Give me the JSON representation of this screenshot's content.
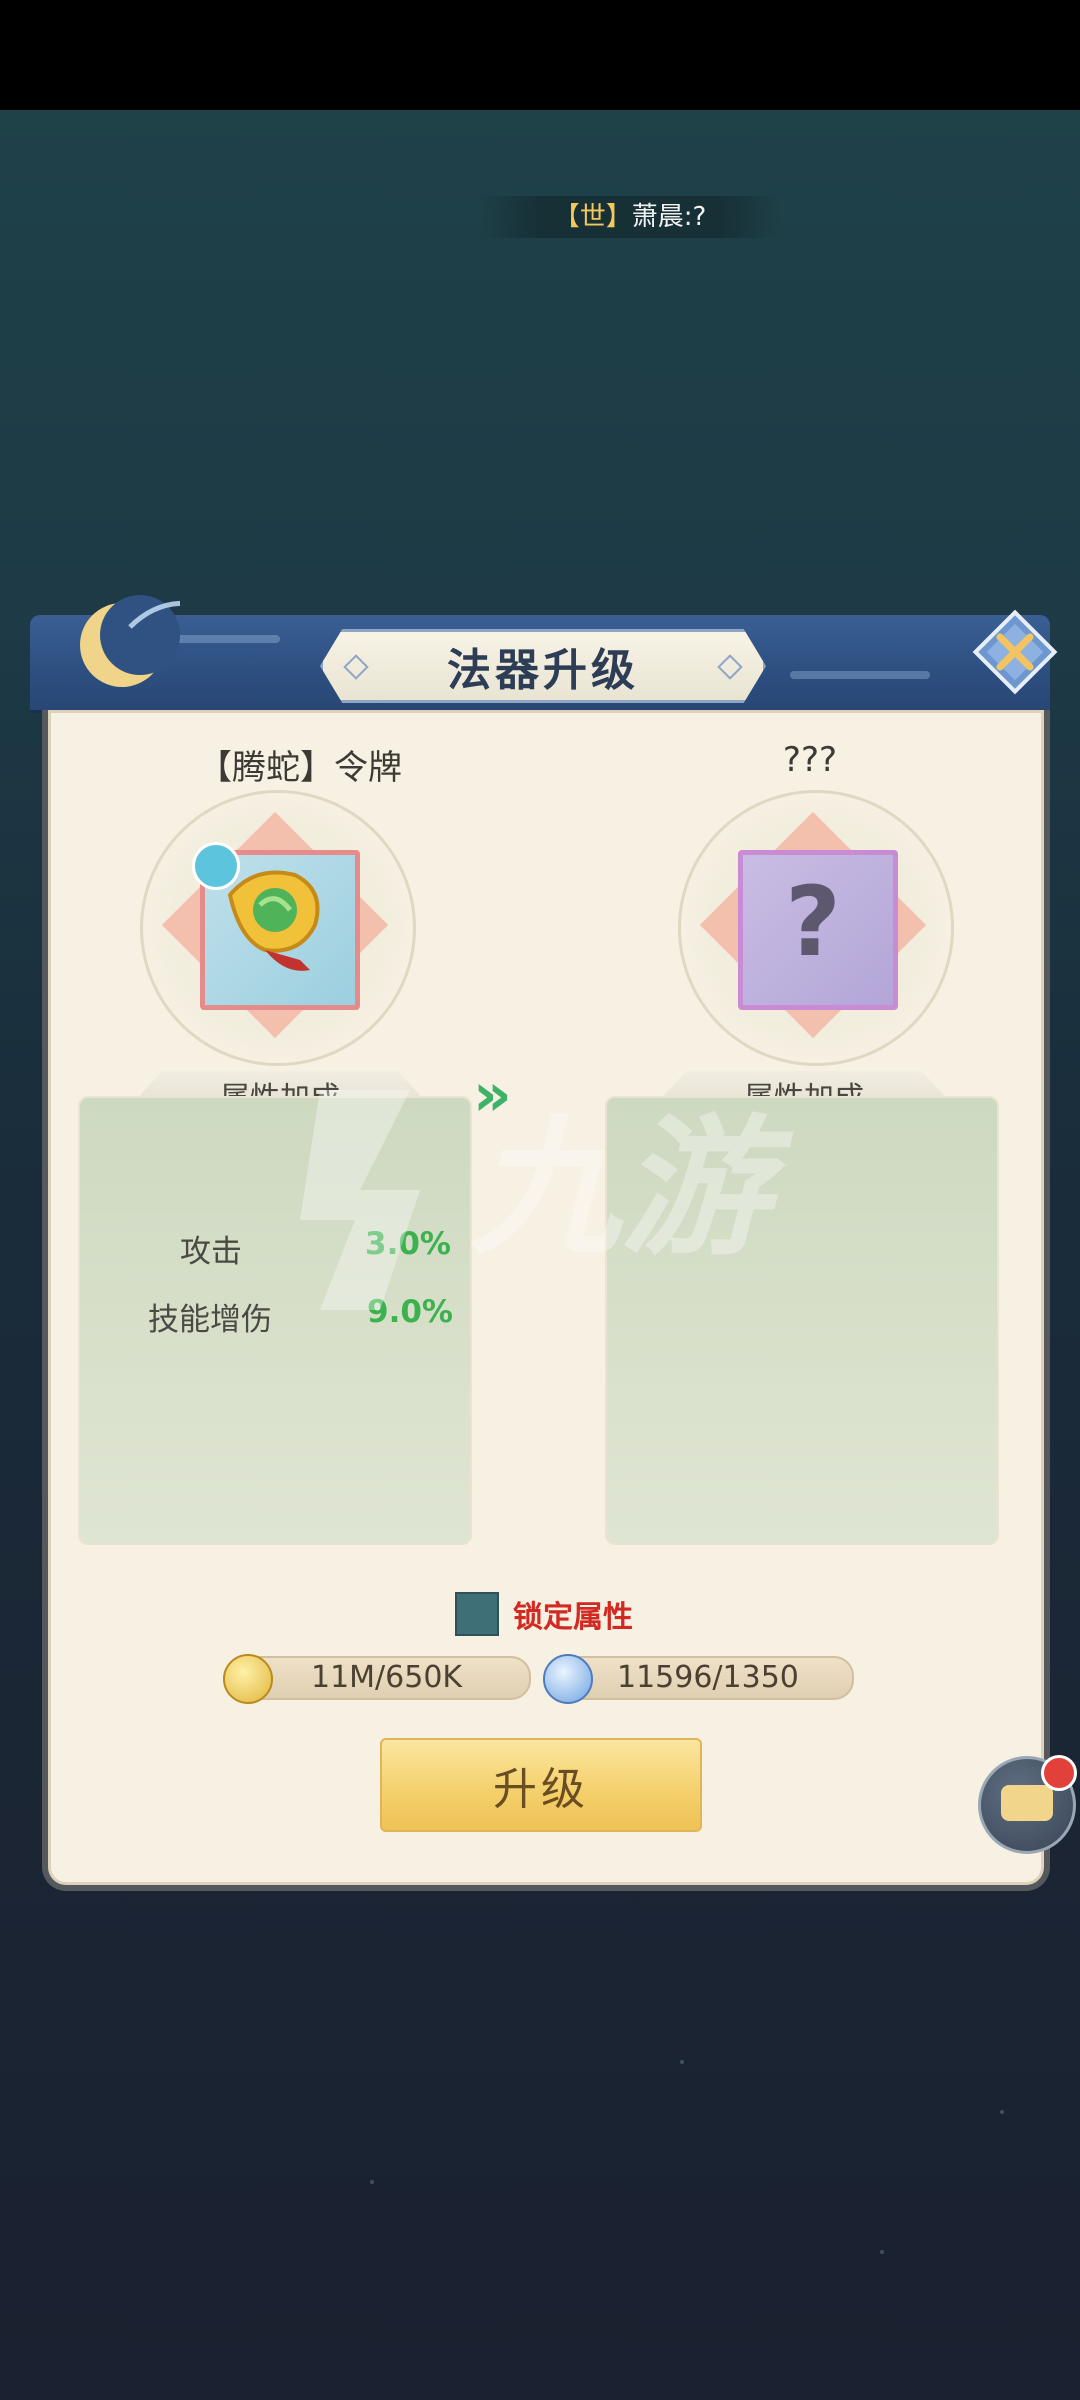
{
  "chat": {
    "tag": "【世】",
    "text": "萧晨:?"
  },
  "dialog": {
    "title": "法器升级",
    "current": {
      "name": "【腾蛇】令牌",
      "section_label": "属性加成",
      "stats": [
        {
          "name": "攻击",
          "value": "3.0%"
        },
        {
          "name": "技能增伤",
          "value": "9.0%"
        }
      ]
    },
    "next": {
      "name": "???",
      "section_label": "属性加成"
    },
    "lock_label": "锁定属性",
    "costs": [
      {
        "icon": "gold-coin-icon",
        "text": "11M/650K"
      },
      {
        "icon": "spirit-crystal-icon",
        "text": "11596/1350"
      }
    ],
    "upgrade_label": "升级"
  },
  "watermark": "九游",
  "colors": {
    "stat_value": "#3bb24e",
    "lock_label": "#d22a22",
    "header_blue": "#2d4f80",
    "upgrade_button": "#f4cf6a"
  }
}
